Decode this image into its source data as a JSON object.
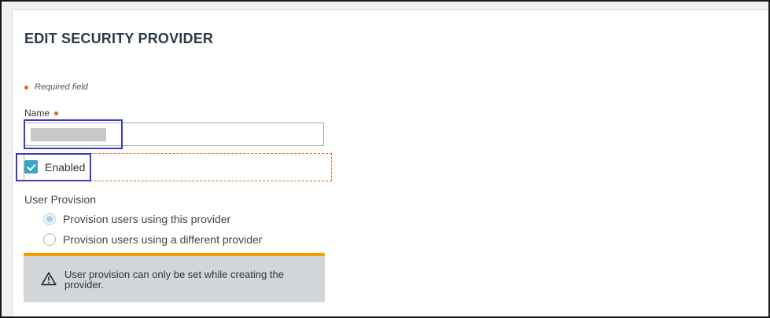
{
  "header": {
    "title": "EDIT SECURITY PROVIDER"
  },
  "form": {
    "required_note": "Required field",
    "name_label": "Name",
    "enabled_label": "Enabled",
    "enabled_checked": true,
    "user_provision_label": "User Provision",
    "provision_options": [
      {
        "label": "Provision users using this provider",
        "selected": true,
        "disabled": true
      },
      {
        "label": "Provision users using a different provider",
        "selected": false,
        "disabled": true
      }
    ]
  },
  "warning": {
    "icon": "warning-triangle-icon",
    "text": "User provision can only be set while creating the provider."
  },
  "colors": {
    "required_dot": "#e8601a",
    "checkbox": "#3ba4c8",
    "warning_accent": "#f4a100",
    "highlight": "#3a3ac6"
  }
}
